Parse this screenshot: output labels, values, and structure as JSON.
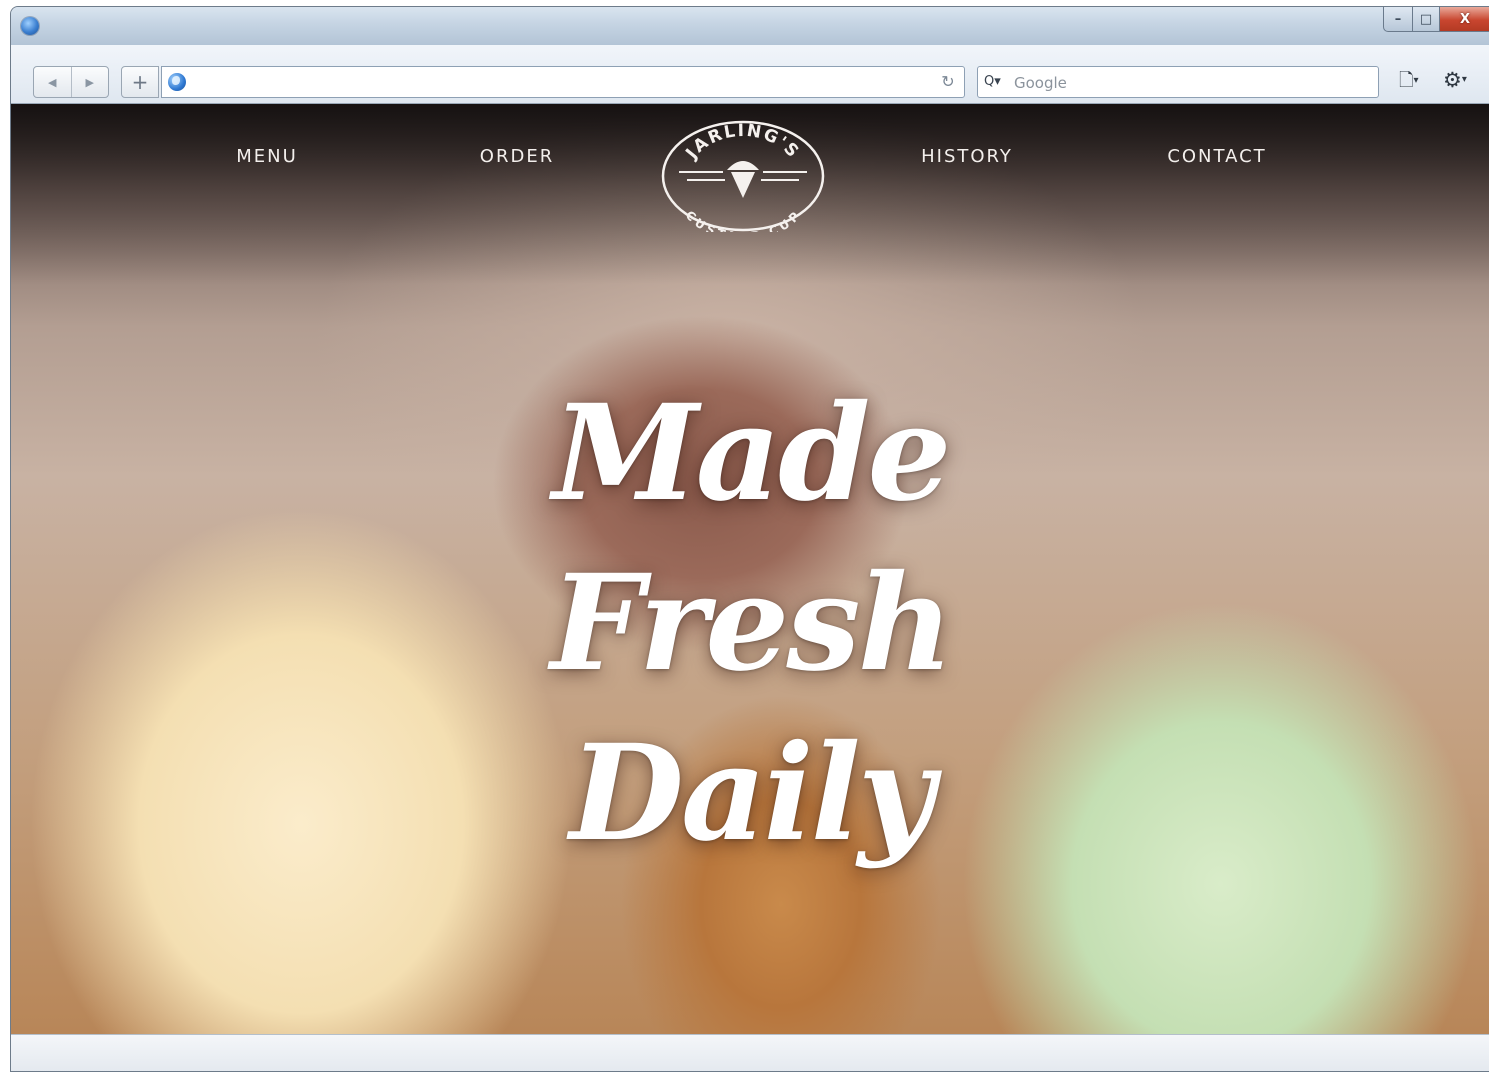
{
  "browser": {
    "window_controls": {
      "minimize": "–",
      "maximize": "□",
      "close": "X"
    },
    "toolbar": {
      "back_icon": "◀",
      "forward_icon": "▶",
      "new_tab_icon": "+",
      "reload_icon": "↻",
      "address_value": "",
      "search_placeholder": "Google",
      "search_icon": "Q▾",
      "page_icon": "🗋",
      "gear_icon": "⚙"
    }
  },
  "site": {
    "nav": [
      {
        "label": "MENU"
      },
      {
        "label": "ORDER"
      },
      {
        "label": "HISTORY"
      },
      {
        "label": "CONTACT"
      }
    ],
    "logo": {
      "top_text": "JARLING'S",
      "bottom_text": "CUSTARD CUP"
    },
    "hero": {
      "line1": "Made",
      "line2": "Fresh",
      "line3": "Daily"
    }
  },
  "colors": {
    "hero_text": "#ffffff",
    "nav_text": "#f3efec",
    "close_button": "#c8462f"
  }
}
